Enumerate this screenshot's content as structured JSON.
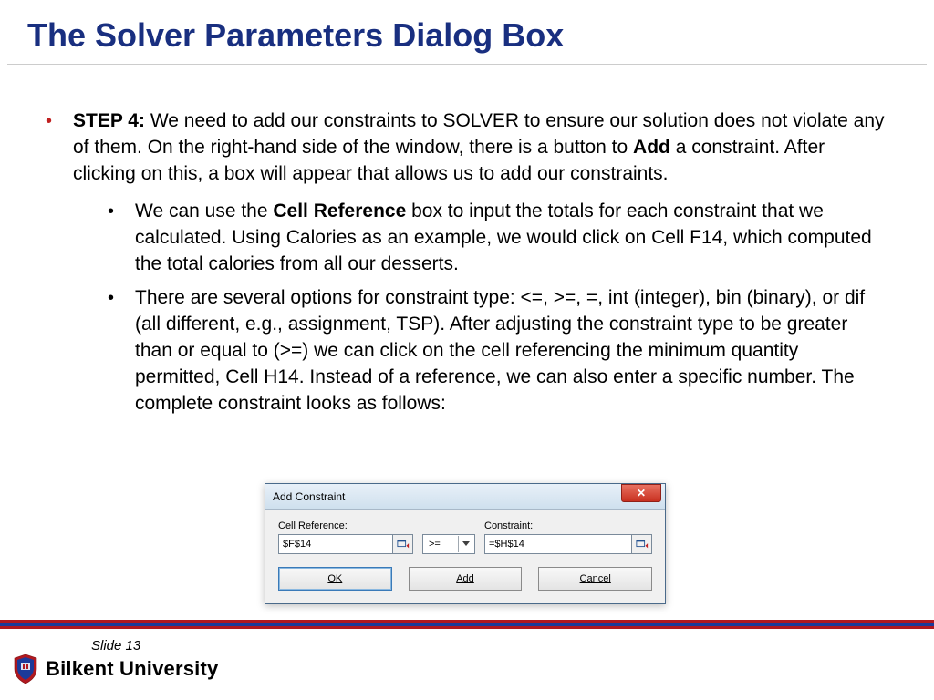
{
  "title": "The Solver Parameters Dialog Box",
  "step_label": "STEP 4:",
  "step_text_a": " We need to add our constraints to SOLVER to ensure our solution does not violate any of them. On the right-hand side of the window, there is a button to ",
  "add_word": "Add",
  "step_text_b": " a constraint. After clicking on this, a box will appear that allows us to add our constraints.",
  "sub1_a": "We can use the ",
  "cellref_word": "Cell Reference",
  "sub1_b": " box to input the totals for each constraint that we calculated. Using Calories as an example, we would click on Cell F14, which computed the total calories from all our desserts.",
  "sub2": "There are several options for constraint type: <=, >=, =, int (integer), bin (binary), or dif (all different, e.g., assignment, TSP). After adjusting the constraint type to be greater than or equal to (>=) we can click on the cell referencing the minimum quantity permitted, Cell H14. Instead of a reference, we can also enter a specific number. The complete constraint looks as follows:",
  "dialog": {
    "title": "Add Constraint",
    "cell_label": "Cell Reference:",
    "cell_value": "$F$14",
    "operator": ">=",
    "constraint_label": "Constraint:",
    "constraint_value": "=$H$14",
    "ok": "OK",
    "add": "Add",
    "cancel": "Cancel"
  },
  "slide": "Slide 13",
  "university": "Bilkent University"
}
